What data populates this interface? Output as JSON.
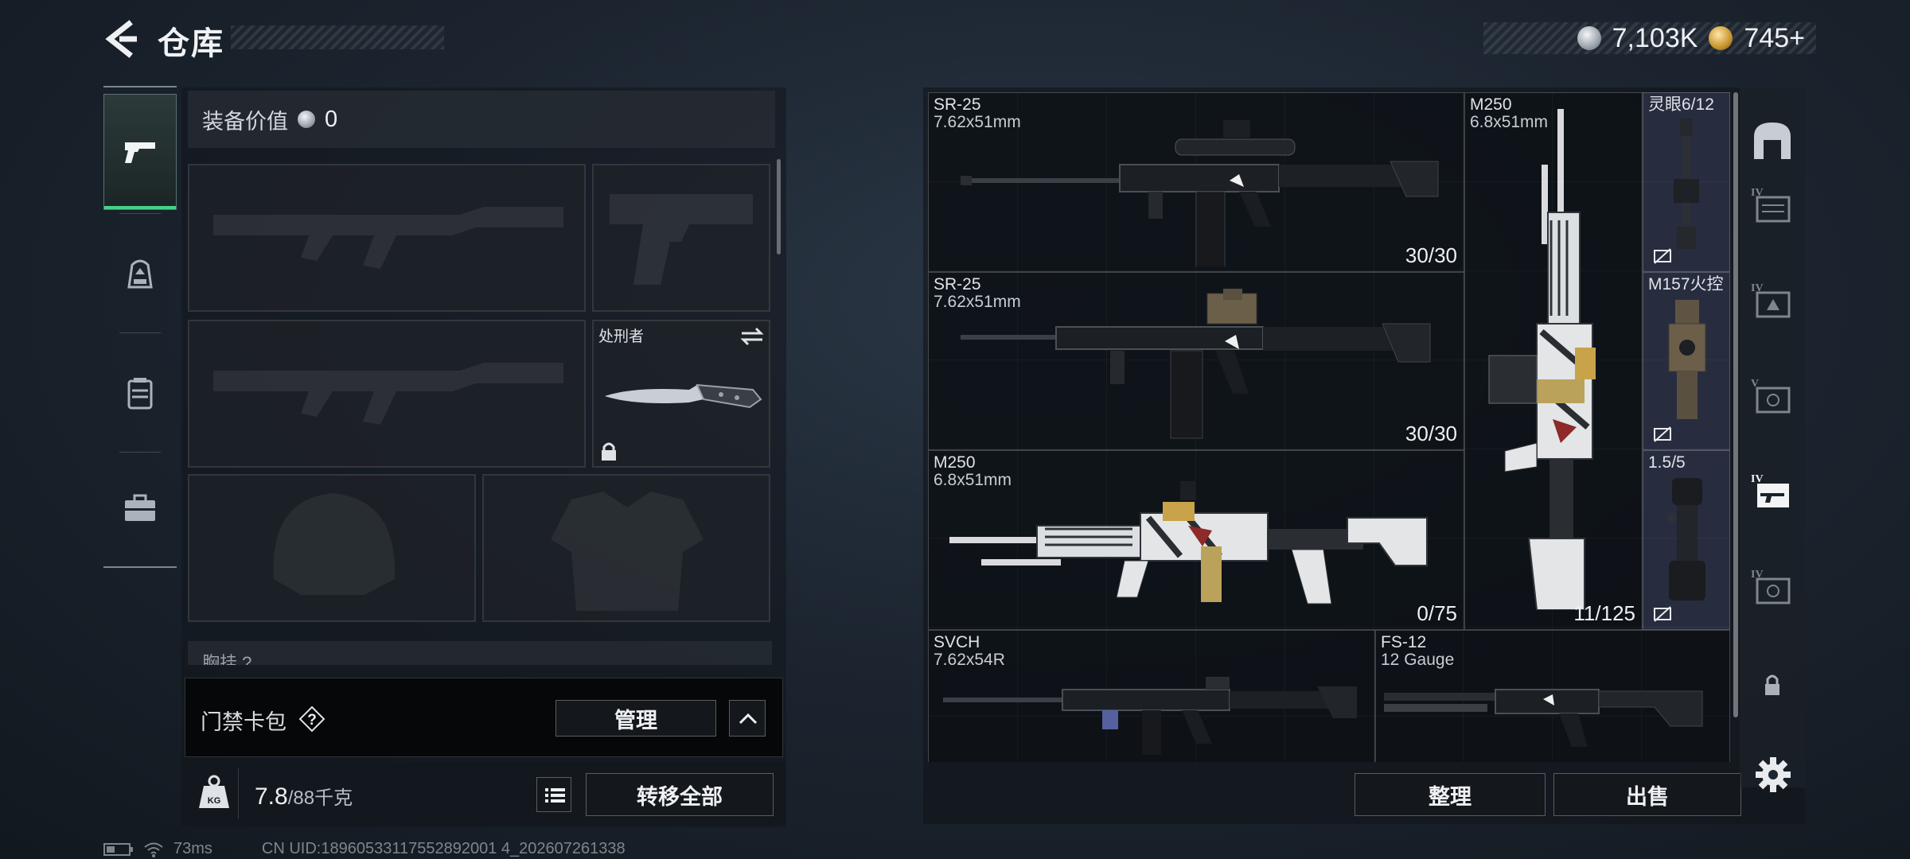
{
  "header": {
    "title": "仓库"
  },
  "currency": {
    "silver": "7,103K",
    "gold": "745+"
  },
  "loadout": {
    "equipment_value_label": "装备价值",
    "equipment_value": "0",
    "knife_name": "处刑者",
    "chest_rig_label": "胸挂",
    "chest_rig_partial": "?"
  },
  "keycard": {
    "label": "门禁卡包",
    "help": "?",
    "manage": "管理"
  },
  "weight": {
    "current": "7.8",
    "max": "/88千克",
    "transfer_all": "转移全部"
  },
  "status": {
    "ping": "73ms",
    "uid": "CN UID:18960533117552892001 4_202607261338"
  },
  "storage": {
    "items": [
      {
        "name": "SR-25",
        "caliber": "7.62x51mm",
        "ammo": "30/30"
      },
      {
        "name": "SR-25",
        "caliber": "7.62x51mm",
        "ammo": "30/30"
      },
      {
        "name": "M250",
        "caliber": "6.8x51mm",
        "ammo": "0/75"
      },
      {
        "name": "M250",
        "caliber": "6.8x51mm",
        "ammo": "11/125"
      },
      {
        "name": "灵眼6/12",
        "caliber": "",
        "ammo": ""
      },
      {
        "name": "M157火控",
        "caliber": "",
        "ammo": ""
      },
      {
        "name": "1.5/5",
        "caliber": "",
        "ammo": ""
      },
      {
        "name": "SVCH",
        "caliber": "7.62x54R",
        "ammo": ""
      },
      {
        "name": "FS-12",
        "caliber": "12 Gauge",
        "ammo": ""
      }
    ],
    "sort": "整理",
    "sell": "出售"
  },
  "containers": {
    "levels": [
      "IV",
      "IV",
      "V",
      "IV",
      "IV"
    ]
  },
  "icons": {
    "back": "back-arrow-icon",
    "weapons": "pistol-icon",
    "helmet": "backpack-icon",
    "vest": "vest-icon",
    "case": "toolbox-icon",
    "settings": "gear-icon"
  },
  "colors": {
    "active_accent": "#43d38a",
    "panel": "#14171b",
    "text": "#eef0f3"
  }
}
